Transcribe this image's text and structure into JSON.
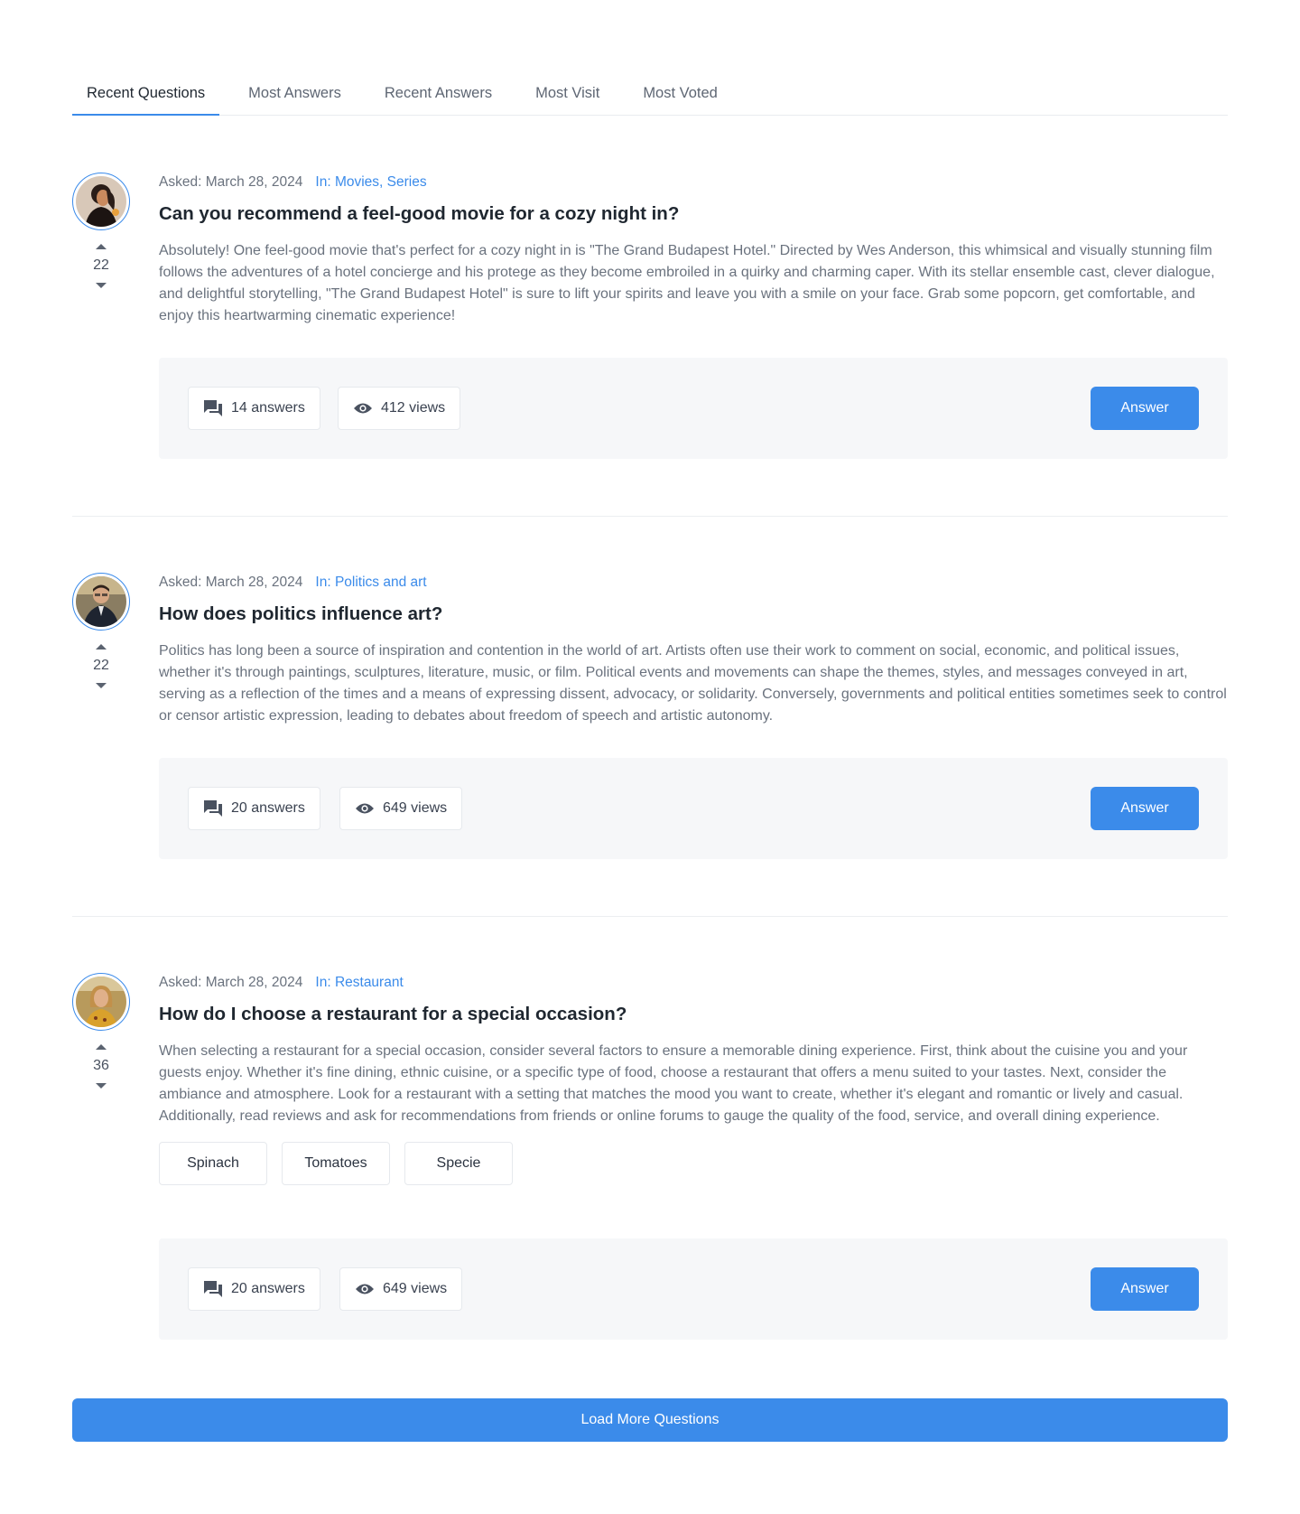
{
  "tabs": [
    {
      "label": "Recent Questions",
      "active": true
    },
    {
      "label": "Most Answers"
    },
    {
      "label": "Recent Answers"
    },
    {
      "label": "Most Visit"
    },
    {
      "label": "Most Voted"
    }
  ],
  "questions": [
    {
      "votes": "22",
      "asked": "Asked: March 28, 2024",
      "category": "In: Movies, Series",
      "title": "Can you recommend a feel-good movie for a cozy night in?",
      "excerpt": "Absolutely! One feel-good movie that's perfect for a cozy night in is \"The Grand Budapest Hotel.\" Directed by Wes Anderson, this whimsical and visually stunning film follows the adventures of a hotel concierge and his protege as they become embroiled in a quirky and charming caper. With its stellar ensemble cast, clever dialogue, and delightful storytelling, \"The Grand Budapest Hotel\" is sure to lift your spirits and leave you with a smile on your face. Grab some popcorn, get comfortable, and enjoy this heartwarming cinematic experience!",
      "answers": "14 answers",
      "views": "412 views",
      "answer_btn": "Answer"
    },
    {
      "votes": "22",
      "asked": "Asked: March 28, 2024",
      "category": "In: Politics and art",
      "title": "How does politics influence art?",
      "excerpt": "Politics has long been a source of inspiration and contention in the world of art. Artists often use their work to comment on social, economic, and political issues, whether it's through paintings, sculptures, literature, music, or film. Political events and movements can shape the themes, styles, and messages conveyed in art, serving as a reflection of the times and a means of expressing dissent, advocacy, or solidarity. Conversely, governments and political entities sometimes seek to control or censor artistic expression, leading to debates about freedom of speech and artistic autonomy.",
      "answers": "20 answers",
      "views": "649 views",
      "answer_btn": "Answer"
    },
    {
      "votes": "36",
      "asked": "Asked: March 28, 2024",
      "category": "In: Restaurant",
      "title": "How do I choose a restaurant for a special occasion?",
      "excerpt": "When selecting a restaurant for a special occasion, consider several factors to ensure a memorable dining experience. First, think about the cuisine you and your guests enjoy. Whether it's fine dining, ethnic cuisine, or a specific type of food, choose a restaurant that offers a menu suited to your tastes. Next, consider the ambiance and atmosphere. Look for a restaurant with a setting that matches the mood you want to create, whether it's elegant and romantic or lively and casual. Additionally, read reviews and ask for recommendations from friends or online forums to gauge the quality of the food, service, and overall dining experience.",
      "tags": [
        "Spinach",
        "Tomatoes",
        "Specie"
      ],
      "answers": "20 answers",
      "views": "649 views",
      "answer_btn": "Answer"
    }
  ],
  "load_more": "Load More Questions",
  "colors": {
    "accent": "#3b8bea",
    "panel": "#f6f7f9",
    "text": "#1f2730",
    "muted": "#6a727e"
  },
  "icons": {
    "answers": "forum-icon",
    "views": "eye-icon",
    "vote_up": "caret-up-icon",
    "vote_down": "caret-down-icon"
  }
}
